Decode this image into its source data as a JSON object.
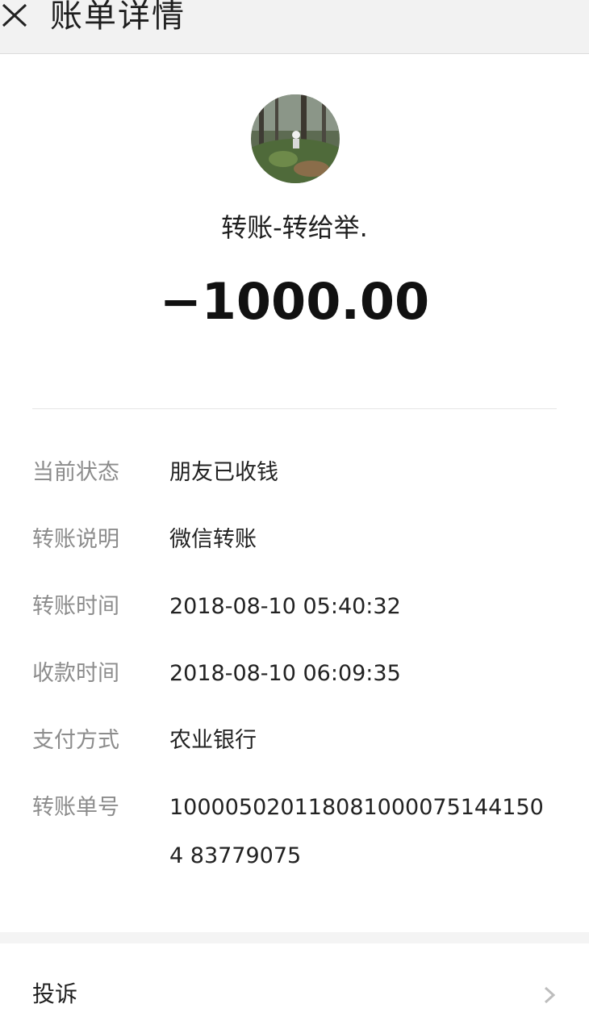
{
  "header": {
    "title": "账单详情",
    "close_icon": "close-icon"
  },
  "transaction": {
    "counterparty": "转账-转给举.",
    "amount": "−1000.00"
  },
  "details": [
    {
      "label": "当前状态",
      "value": "朋友已收钱"
    },
    {
      "label": "转账说明",
      "value": "微信转账"
    },
    {
      "label": "转账时间",
      "value": "2018-08-10 05:40:32"
    },
    {
      "label": "收款时间",
      "value": "2018-08-10 06:09:35"
    },
    {
      "label": "支付方式",
      "value": "农业银行"
    },
    {
      "label": "转账单号",
      "value": "1000050201180810000751441504 83779075"
    }
  ],
  "footer": {
    "complain_label": "投诉",
    "chevron_icon": "chevron-right-icon"
  }
}
